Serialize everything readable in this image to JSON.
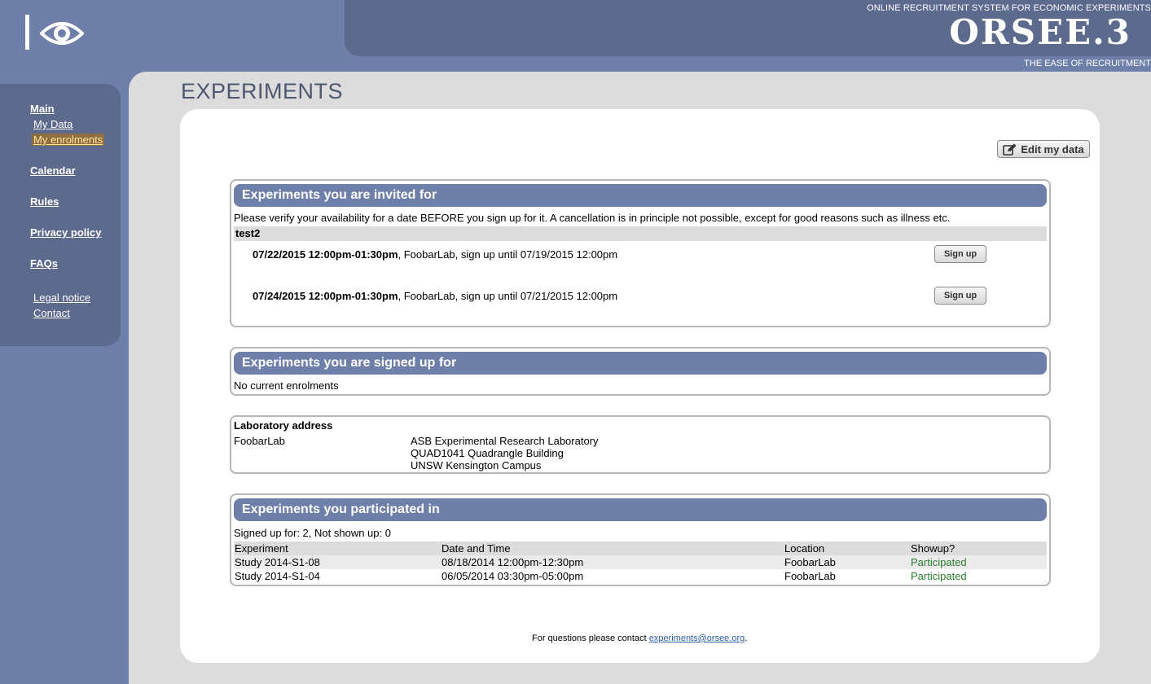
{
  "header": {
    "tagline_top": "ONLINE RECRUITMENT SYSTEM FOR ECONOMIC EXPERIMENTS",
    "brand": "ORSEE.3",
    "tagline_bottom": "THE EASE OF RECRUITMENT"
  },
  "sidebar": {
    "items": [
      {
        "label": "Main"
      },
      {
        "label": "My Data"
      },
      {
        "label": "My enrolments"
      },
      {
        "label": "Calendar"
      },
      {
        "label": "Rules"
      },
      {
        "label": "Privacy policy"
      },
      {
        "label": "FAQs"
      },
      {
        "label": "Legal notice"
      },
      {
        "label": "Contact"
      }
    ]
  },
  "page_title": "EXPERIMENTS",
  "edit_button": "Edit my data",
  "invited": {
    "header": "Experiments you are invited for",
    "notice": "Please verify your availability for a date BEFORE you sign up for it. A cancellation is in principle not possible, except for good reasons such as illness etc.",
    "experiment_name": "test2",
    "sessions": [
      {
        "date": "07/22/2015 12:00pm-01:30pm",
        "details": ", FoobarLab, sign up until 07/19/2015 12:00pm",
        "button": "Sign up"
      },
      {
        "date": "07/24/2015 12:00pm-01:30pm",
        "details": ", FoobarLab, sign up until 07/21/2015 12:00pm",
        "button": "Sign up"
      }
    ]
  },
  "signed_up": {
    "header": "Experiments you are signed up for",
    "empty_text": "No current enrolments"
  },
  "lab": {
    "heading": "Laboratory address",
    "name": "FoobarLab",
    "address_lines": [
      "ASB Experimental Research Laboratory",
      "QUAD1041 Quadrangle Building",
      "UNSW Kensington Campus"
    ]
  },
  "participated": {
    "header": "Experiments you participated in",
    "summary": "Signed up for: 2, Not shown up: 0",
    "columns": [
      "Experiment",
      "Date and Time",
      "Location",
      "Showup?"
    ],
    "rows": [
      [
        "Study 2014-S1-08",
        "08/18/2014 12:00pm-12:30pm",
        "FoobarLab",
        "Participated"
      ],
      [
        "Study 2014-S1-04",
        "06/05/2014 03:30pm-05:00pm",
        "FoobarLab",
        "Participated"
      ]
    ]
  },
  "footer": {
    "text": "For questions please contact ",
    "email": "experiments@orsee.org",
    "suffix": "."
  },
  "colors": {
    "accent": "#6e7fa9",
    "dark_accent": "#5c6a8d",
    "participated": "#2d7a2d"
  }
}
